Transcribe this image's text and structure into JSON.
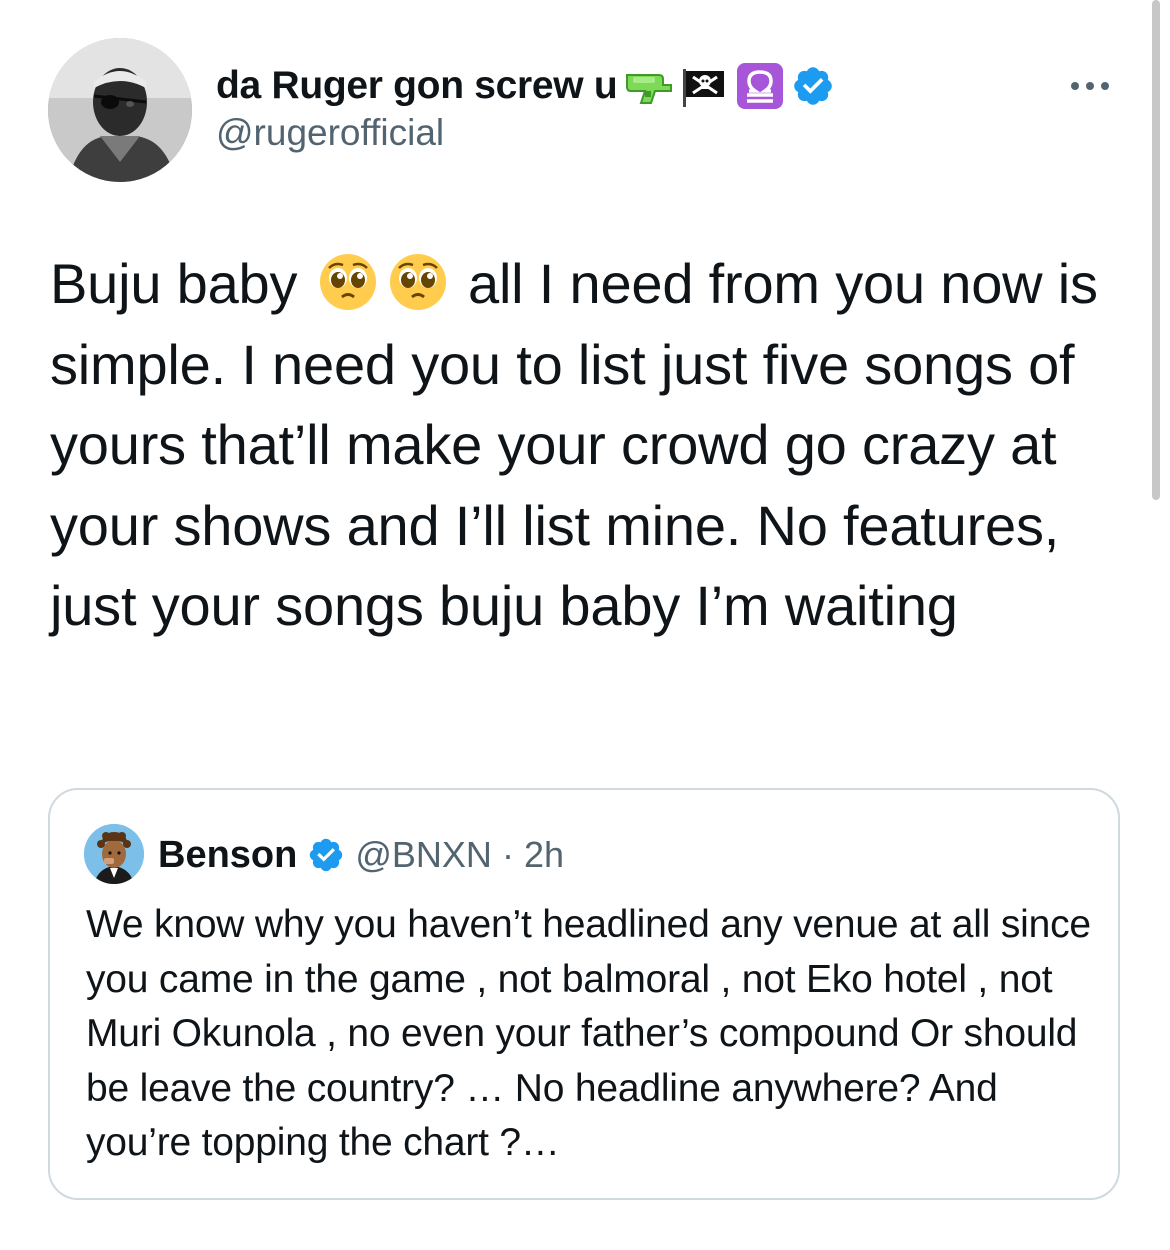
{
  "author": {
    "display_name": "da Ruger gon screw u",
    "name_emojis": [
      "water-pistol",
      "pirate-flag",
      "libra-sign"
    ],
    "verified": true,
    "handle": "@rugerofficial"
  },
  "tweet": {
    "lead": "Buju baby",
    "lead_emojis": [
      "pleading-face",
      "pleading-face"
    ],
    "body": " all I need from you now is simple. I need you to list just five songs of yours that’ll make your crowd go crazy at your shows and I’ll list mine. No features, just your songs buju baby I’m waiting"
  },
  "quoted": {
    "display_name": "Benson",
    "verified": true,
    "handle": "@BNXN",
    "separator": "·",
    "time": "2h",
    "text": "We know why you haven’t headlined  any venue at all since you came in the game , not balmoral , not Eko hotel ,  not Muri Okunola , no even your father’s compound Or should be leave the country? … No headline anywhere? And you’re topping the chart ?…"
  },
  "colors": {
    "verified_blue": "#1d9bf0",
    "secondary_text": "#536471",
    "border": "#cfd9de"
  }
}
